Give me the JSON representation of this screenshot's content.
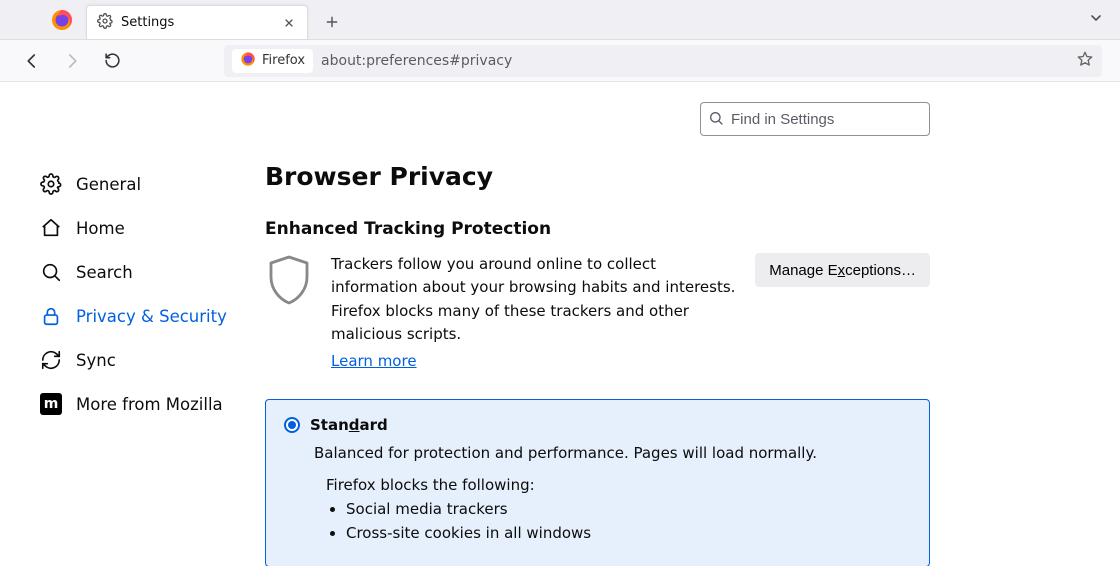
{
  "tab": {
    "title": "Settings"
  },
  "urlbar": {
    "identity_label": "Firefox",
    "url": "about:preferences#privacy"
  },
  "search": {
    "placeholder": "Find in Settings"
  },
  "sidebar": {
    "items": [
      {
        "label": "General"
      },
      {
        "label": "Home"
      },
      {
        "label": "Search"
      },
      {
        "label": "Privacy & Security"
      },
      {
        "label": "Sync"
      },
      {
        "label": "More from Mozilla"
      }
    ]
  },
  "main": {
    "page_title": "Browser Privacy",
    "section_title": "Enhanced Tracking Protection",
    "etp_description": "Trackers follow you around online to collect information about your browsing habits and interests. Firefox blocks many of these trackers and other malicious scripts.",
    "learn_more": "Learn more",
    "manage_exceptions_pre": "Manage E",
    "manage_exceptions_ul": "x",
    "manage_exceptions_post": "ceptions…",
    "standard": {
      "label_pre": "Stan",
      "label_ul": "d",
      "label_post": "ard",
      "description": "Balanced for protection and performance. Pages will load normally.",
      "blocks_heading": "Firefox blocks the following:",
      "blocks": [
        "Social media trackers",
        "Cross-site cookies in all windows"
      ]
    }
  }
}
